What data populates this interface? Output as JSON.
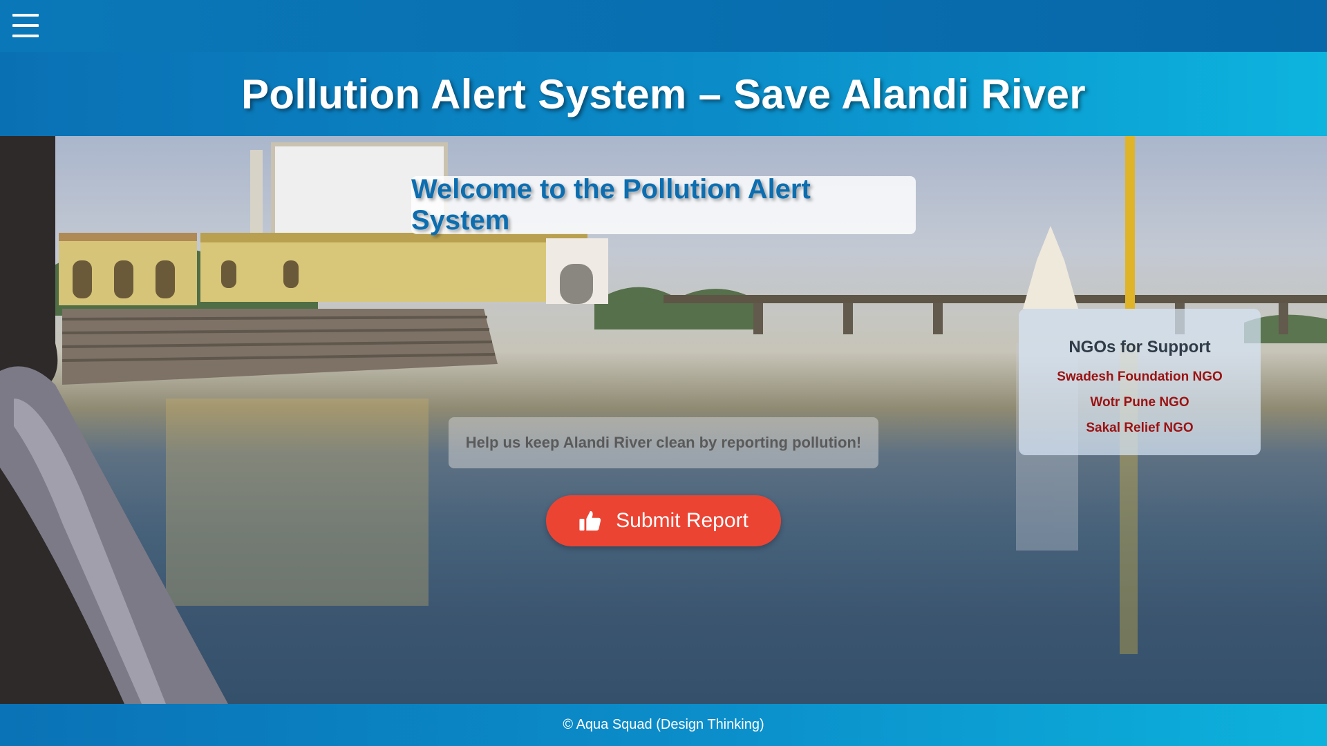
{
  "topbar": {
    "menu_icon": "hamburger-menu-icon"
  },
  "header": {
    "title": "Pollution Alert System – Save Alandi River"
  },
  "hero": {
    "background": "river-ghat-photo",
    "welcome": "Welcome to the Pollution Alert System",
    "tagline": "Help us keep Alandi River clean by reporting pollution!",
    "submit_label": "Submit Report",
    "submit_icon": "thumbs-up-icon"
  },
  "ngo": {
    "title": "NGOs for Support",
    "items": [
      "Swadesh Foundation NGO",
      "Wotr Pune NGO",
      "Sakal Relief NGO"
    ]
  },
  "footer": {
    "text": "© Aqua Squad (Design Thinking)"
  },
  "colors": {
    "header_blue": "#0a78b8",
    "title_blue": "#0c6eb0",
    "button_red": "#ec4433",
    "ngo_link": "#9b1212"
  }
}
